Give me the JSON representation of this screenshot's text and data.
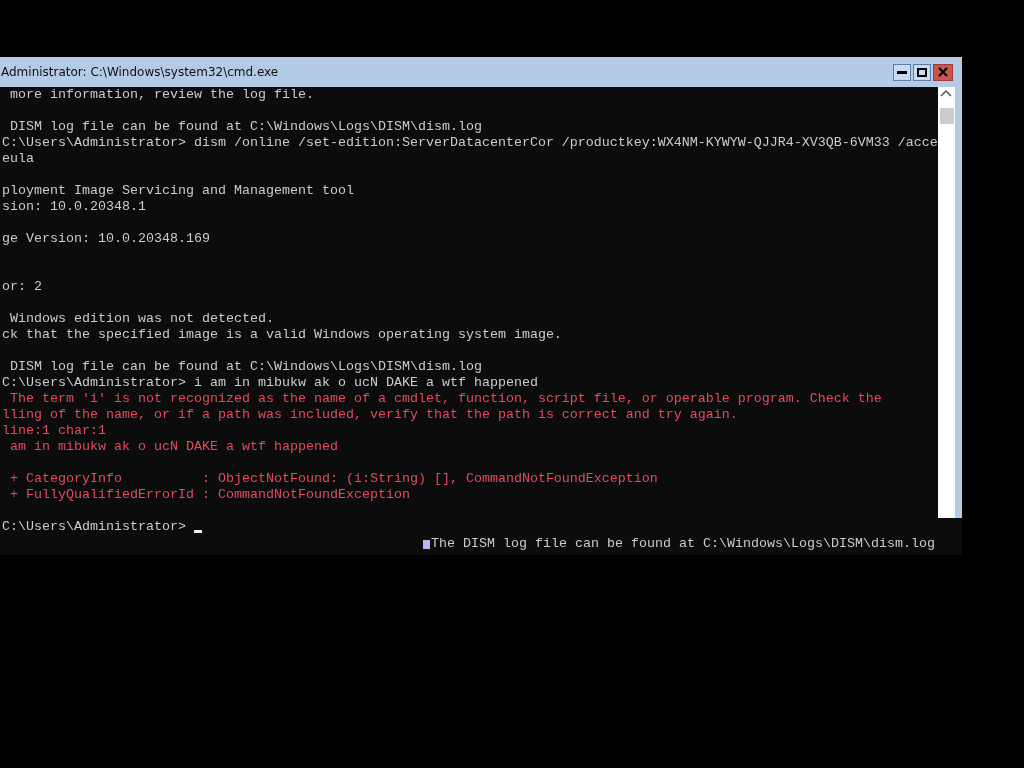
{
  "window": {
    "title": "Administrator: C:\\Windows\\system32\\cmd.exe"
  },
  "console": {
    "lines": [
      {
        "kind": "output",
        "text": " more information, review the log file."
      },
      {
        "kind": "blank"
      },
      {
        "kind": "output",
        "text": " DISM log file can be found at C:\\Windows\\Logs\\DISM\\dism.log"
      },
      {
        "kind": "output",
        "text": "C:\\Users\\Administrator> dism /online /set-edition:ServerDatacenterCor /productkey:WX4NM-KYWYW-QJJR4-XV3QB-6VM33 /acce"
      },
      {
        "kind": "output",
        "text": "eula"
      },
      {
        "kind": "blank"
      },
      {
        "kind": "output",
        "text": "ployment Image Servicing and Management tool"
      },
      {
        "kind": "output",
        "text": "sion: 10.0.20348.1"
      },
      {
        "kind": "blank"
      },
      {
        "kind": "output",
        "text": "ge Version: 10.0.20348.169"
      },
      {
        "kind": "blank"
      },
      {
        "kind": "blank"
      },
      {
        "kind": "output",
        "text": "or: 2"
      },
      {
        "kind": "blank"
      },
      {
        "kind": "output",
        "text": " Windows edition was not detected."
      },
      {
        "kind": "output",
        "text": "ck that the specified image is a valid Windows operating system image."
      },
      {
        "kind": "blank"
      },
      {
        "kind": "output",
        "text": " DISM log file can be found at C:\\Windows\\Logs\\DISM\\dism.log"
      },
      {
        "kind": "output",
        "text": "C:\\Users\\Administrator> i am in mibukw ak o ucN DAKE a wtf happened"
      },
      {
        "kind": "error",
        "text": " The term 'i' is not recognized as the name of a cmdlet, function, script file, or operable program. Check the"
      },
      {
        "kind": "error",
        "text": "lling of the name, or if a path was included, verify that the path is correct and try again."
      },
      {
        "kind": "error",
        "text": "line:1 char:1"
      },
      {
        "kind": "error",
        "text": " am in mibukw ak o ucN DAKE a wtf happened"
      },
      {
        "kind": "blank"
      },
      {
        "kind": "error",
        "text": " + CategoryInfo          : ObjectNotFound: (i:String) [], CommandNotFoundException"
      },
      {
        "kind": "error",
        "text": " + FullyQualifiedErrorId : CommandNotFoundException"
      },
      {
        "kind": "blank"
      },
      {
        "kind": "prompt",
        "text": "C:\\Users\\Administrator> "
      }
    ],
    "stray_text": "The DISM log file can be found at C:\\Windows\\Logs\\DISM\\dism.log"
  }
}
